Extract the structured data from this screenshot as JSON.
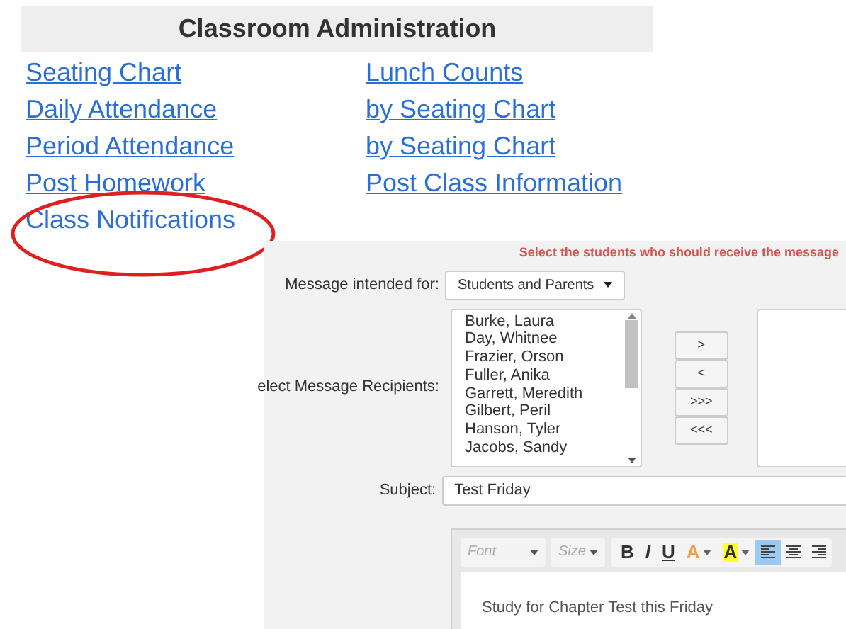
{
  "admin": {
    "title": "Classroom Administration",
    "columns": [
      [
        {
          "label": "Seating Chart",
          "underlined": true
        },
        {
          "label": "Daily Attendance",
          "underlined": true
        },
        {
          "label": "Period Attendance",
          "underlined": true
        },
        {
          "label": "Post Homework",
          "underlined": true
        },
        {
          "label": "Class Notifications",
          "underlined": false
        }
      ],
      [
        {
          "label": "Lunch Counts",
          "underlined": true
        },
        {
          "label": "by Seating Chart",
          "underlined": true
        },
        {
          "label": "by Seating Chart",
          "underlined": true
        },
        {
          "label": "Post Class Information",
          "underlined": true
        }
      ]
    ]
  },
  "message_form": {
    "hint": "Select the students who should receive the message",
    "intended_label": "Message intended for:",
    "intended_value": "Students and Parents",
    "recipients_label": "elect Message Recipients:",
    "students": [
      "Burke, Laura",
      "Day, Whitnee",
      "Frazier, Orson",
      "Fuller, Anika",
      "Garrett, Meredith",
      "Gilbert, Peril",
      "Hanson, Tyler",
      "Jacobs, Sandy"
    ],
    "move_buttons": [
      ">",
      "<",
      ">>>",
      "<<<"
    ],
    "subject_label": "Subject:",
    "subject_value": "Test Friday",
    "editor": {
      "font_placeholder": "Font",
      "size_placeholder": "Size",
      "tools": [
        {
          "kind": "bold",
          "label": "B"
        },
        {
          "kind": "italic",
          "label": "I"
        },
        {
          "kind": "underline",
          "label": "U"
        },
        {
          "kind": "text-color",
          "label": "A"
        },
        {
          "kind": "bg-color",
          "label": "A"
        }
      ],
      "alignments": [
        {
          "kind": "left",
          "selected": true
        },
        {
          "kind": "center",
          "selected": false
        },
        {
          "kind": "right",
          "selected": false
        }
      ],
      "body": "Study for Chapter Test this Friday"
    }
  }
}
